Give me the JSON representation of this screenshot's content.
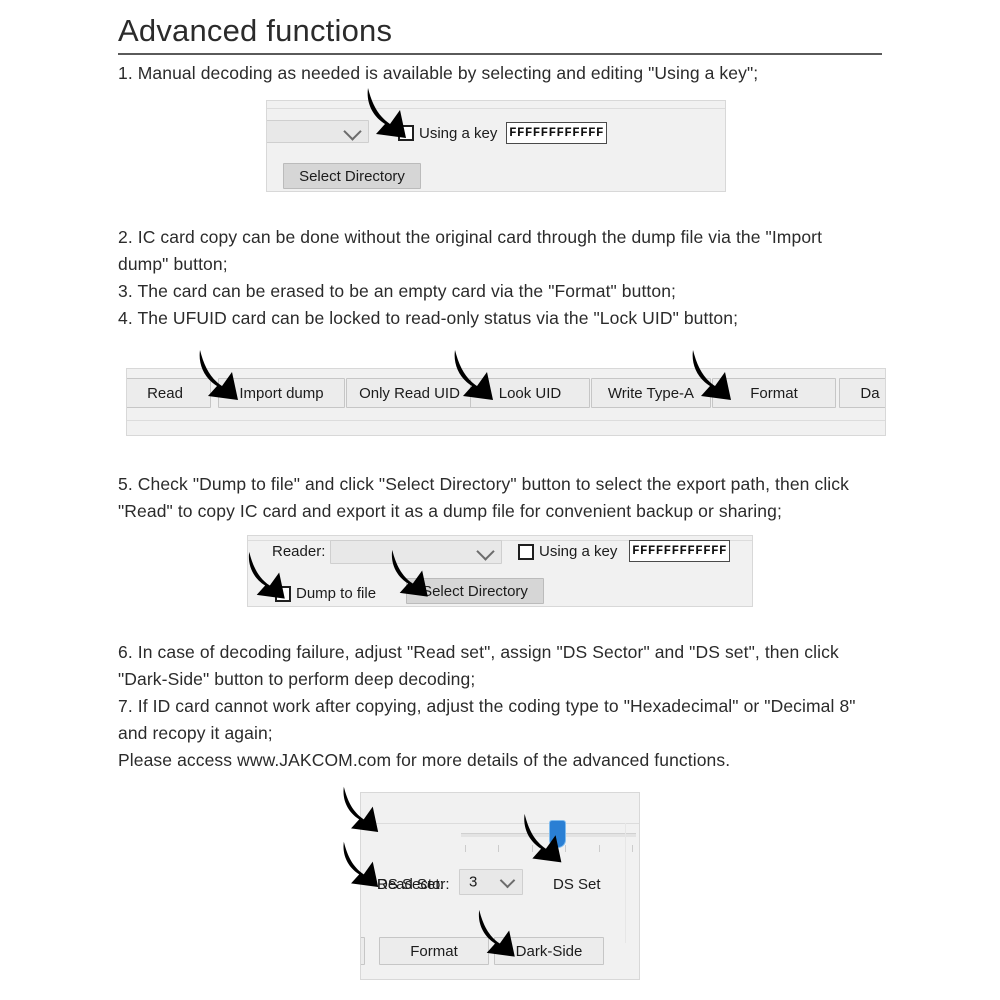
{
  "page": {
    "title": "Advanced functions"
  },
  "steps": {
    "s1": [
      "1. Manual decoding as needed is available by selecting and editing \"Using a key\";"
    ],
    "s2to4": [
      "2. IC card copy can be done without the original card through the dump file via the \"Import",
      "dump\" button;",
      "3. The card can be erased to be an empty card via the \"Format\" button;",
      "4. The UFUID card can be locked to read-only status via the \"Lock UID\" button;"
    ],
    "s5": [
      "5. Check \"Dump to file\" and click \"Select Directory\" button to select the export path, then click",
      "\"Read\" to copy IC card and export it as a dump file for convenient backup or sharing;"
    ],
    "s6to7": [
      "6. In case of decoding failure, adjust \"Read set\", assign \"DS Sector\" and \"DS set\", then click",
      "\"Dark-Side\" button to perform deep decoding;",
      "7. If ID card cannot work after copying, adjust the coding type to \"Hexadecimal\" or \"Decimal 8\"",
      "and recopy it again;",
      "Please access www.JAKCOM.com for more details of the advanced functions."
    ]
  },
  "panel1": {
    "reader_combo_value": "",
    "using_key_label": "Using a key",
    "key_value": "FFFFFFFFFFFF",
    "select_directory_label": "Select Directory"
  },
  "toolbar": {
    "buttons": [
      {
        "label": "Read"
      },
      {
        "label": "Import dump"
      },
      {
        "label": "Only Read UID"
      },
      {
        "label": "Look UID"
      },
      {
        "label": "Write Type-A"
      },
      {
        "label": "Format"
      },
      {
        "label": "Da"
      }
    ]
  },
  "panel2": {
    "reader_label": "Reader:",
    "reader_combo_value": "",
    "using_key_label": "Using a key",
    "key_value": "FFFFFFFFFFFF",
    "dump_to_file_label": "Dump to file",
    "select_directory_label": "Select Directory"
  },
  "panel3": {
    "read_set_label": "Read Set:",
    "ds_sector_label": "DS Sector:",
    "ds_sector_value": "3",
    "ds_set_label": "DS Set",
    "format_label": "Format",
    "dark_side_label": "Dark-Side"
  },
  "colors": {
    "text": "#2b2b2b",
    "rule": "#5a5a5a",
    "panel_bg": "#f1f1f1",
    "button_bg": "#e0e0e0",
    "slider_accent": "#2a7fd4",
    "arrow": "#000000"
  }
}
